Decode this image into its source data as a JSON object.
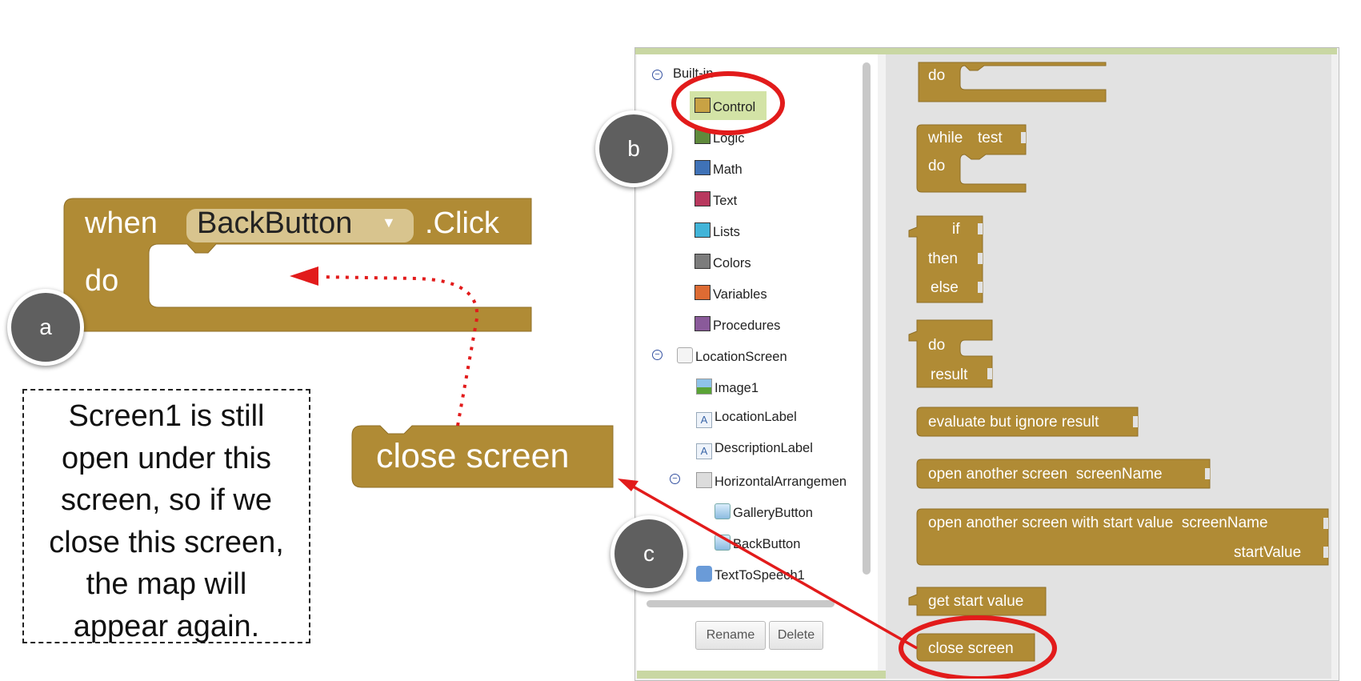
{
  "main_block": {
    "when": "when",
    "component": "BackButton",
    "dropdown_arrow": "▼",
    "event": ".Click",
    "do": "do"
  },
  "dragged_block": {
    "label": "close screen"
  },
  "callouts": {
    "a": "a",
    "b": "b",
    "c": "c"
  },
  "note": {
    "lines": [
      "Screen1 is still",
      "open under this",
      "screen, so if we",
      "close this screen,",
      "the map will",
      "appear again."
    ]
  },
  "tree": {
    "builtin": "Built-in",
    "categories": [
      {
        "label": "Control",
        "color": "#c8a244"
      },
      {
        "label": "Logic",
        "color": "#5f8a3c"
      },
      {
        "label": "Math",
        "color": "#3f72b7"
      },
      {
        "label": "Text",
        "color": "#b8385e"
      },
      {
        "label": "Lists",
        "color": "#41b4d8"
      },
      {
        "label": "Colors",
        "color": "#7c7c7c"
      },
      {
        "label": "Variables",
        "color": "#dd6b33"
      },
      {
        "label": "Procedures",
        "color": "#8a5a9a"
      }
    ],
    "screen": "LocationScreen",
    "components": [
      "Image1",
      "LocationLabel",
      "DescriptionLabel",
      "HorizontalArrangemen",
      "GalleryButton",
      "BackButton",
      "TextToSpeech1"
    ],
    "rename": "Rename",
    "delete": "Delete"
  },
  "drawer": {
    "do_top": "do",
    "while": "while",
    "test": "test",
    "while_do": "do",
    "if": "if",
    "then": "then",
    "else": "else",
    "do_result_do": "do",
    "result": "result",
    "evaluate": "evaluate but ignore result",
    "open_another": "open another screen  screenName",
    "open_with_value": "open another screen with start value  screenName",
    "start_value": "startValue",
    "get_start_value": "get start value",
    "close_screen": "close screen"
  },
  "colors": {
    "block": "#b08b35",
    "block_dark": "#8f6f27",
    "arrow": "#e21b1b",
    "highlight": "#d3e3a6",
    "callout": "#5f5f5f"
  }
}
